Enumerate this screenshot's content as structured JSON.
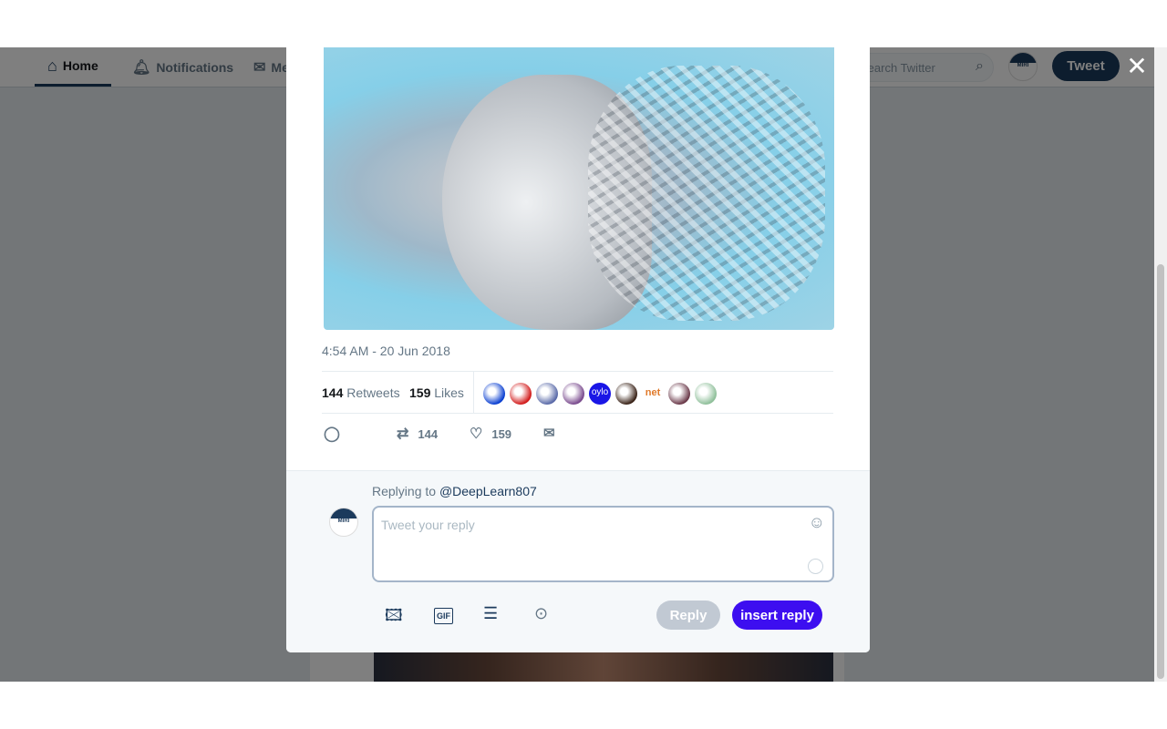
{
  "nav": {
    "home": "Home",
    "notifications": "Notifications",
    "messages": "Messages",
    "search_placeholder": "Search Twitter",
    "tweet_button": "Tweet",
    "avatar_text": "MIRI"
  },
  "tweet": {
    "timestamp": "4:54 AM - 20 Jun 2018",
    "retweets_count": "144",
    "retweets_label": "Retweets",
    "likes_count": "159",
    "likes_label": "Likes",
    "favoriters": [
      "#0a3fd1",
      "#d21b1b",
      "#5a6aa8",
      "#7a4b8e",
      "#1a16e6",
      "#3a2318",
      "#e07a2a",
      "#6b3a4a",
      "#8fbf9a"
    ],
    "favoriter_texts": {
      "oylo": "oylo",
      "net": "net"
    },
    "action_retweets": "144",
    "action_likes": "159"
  },
  "reply": {
    "replying_to_label": "Replying to",
    "replying_to_handle": "@DeepLearn807",
    "placeholder": "Tweet your reply",
    "reply_button": "Reply",
    "insert_reply_button": "insert reply",
    "avatar_text": "MIRI"
  },
  "colors": {
    "accent": "#1b3a5c",
    "insert_reply": "#3d0ef0",
    "reply_disabled": "#c1c9d3"
  }
}
